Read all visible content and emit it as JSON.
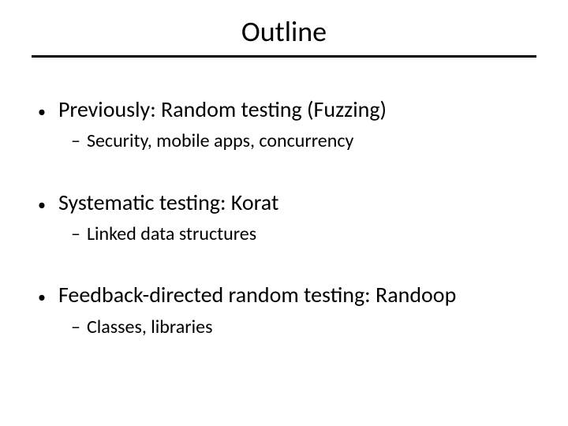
{
  "title": "Outline",
  "items": [
    {
      "main": "Previously: Random testing (Fuzzing)",
      "sub": "Security, mobile apps, concurrency"
    },
    {
      "main": "Systematic testing: Korat",
      "sub": "Linked data structures"
    },
    {
      "main": "Feedback-directed random testing: Randoop",
      "sub": "Classes, libraries"
    }
  ]
}
